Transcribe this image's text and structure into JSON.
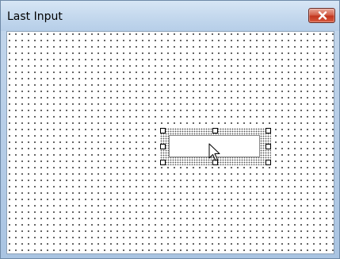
{
  "window": {
    "title": "Last Input",
    "close_icon": "close-icon"
  },
  "designer": {
    "grid": "dotted-grid",
    "selected_control": "textbox",
    "selection_handles": 8,
    "pointer_icon": "arrow-cursor-icon"
  },
  "colors": {
    "title_bar": "#c5d9ee",
    "close_button": "#c8442a",
    "grid_dot": "#3a3a3a",
    "client": "#ffffff"
  }
}
